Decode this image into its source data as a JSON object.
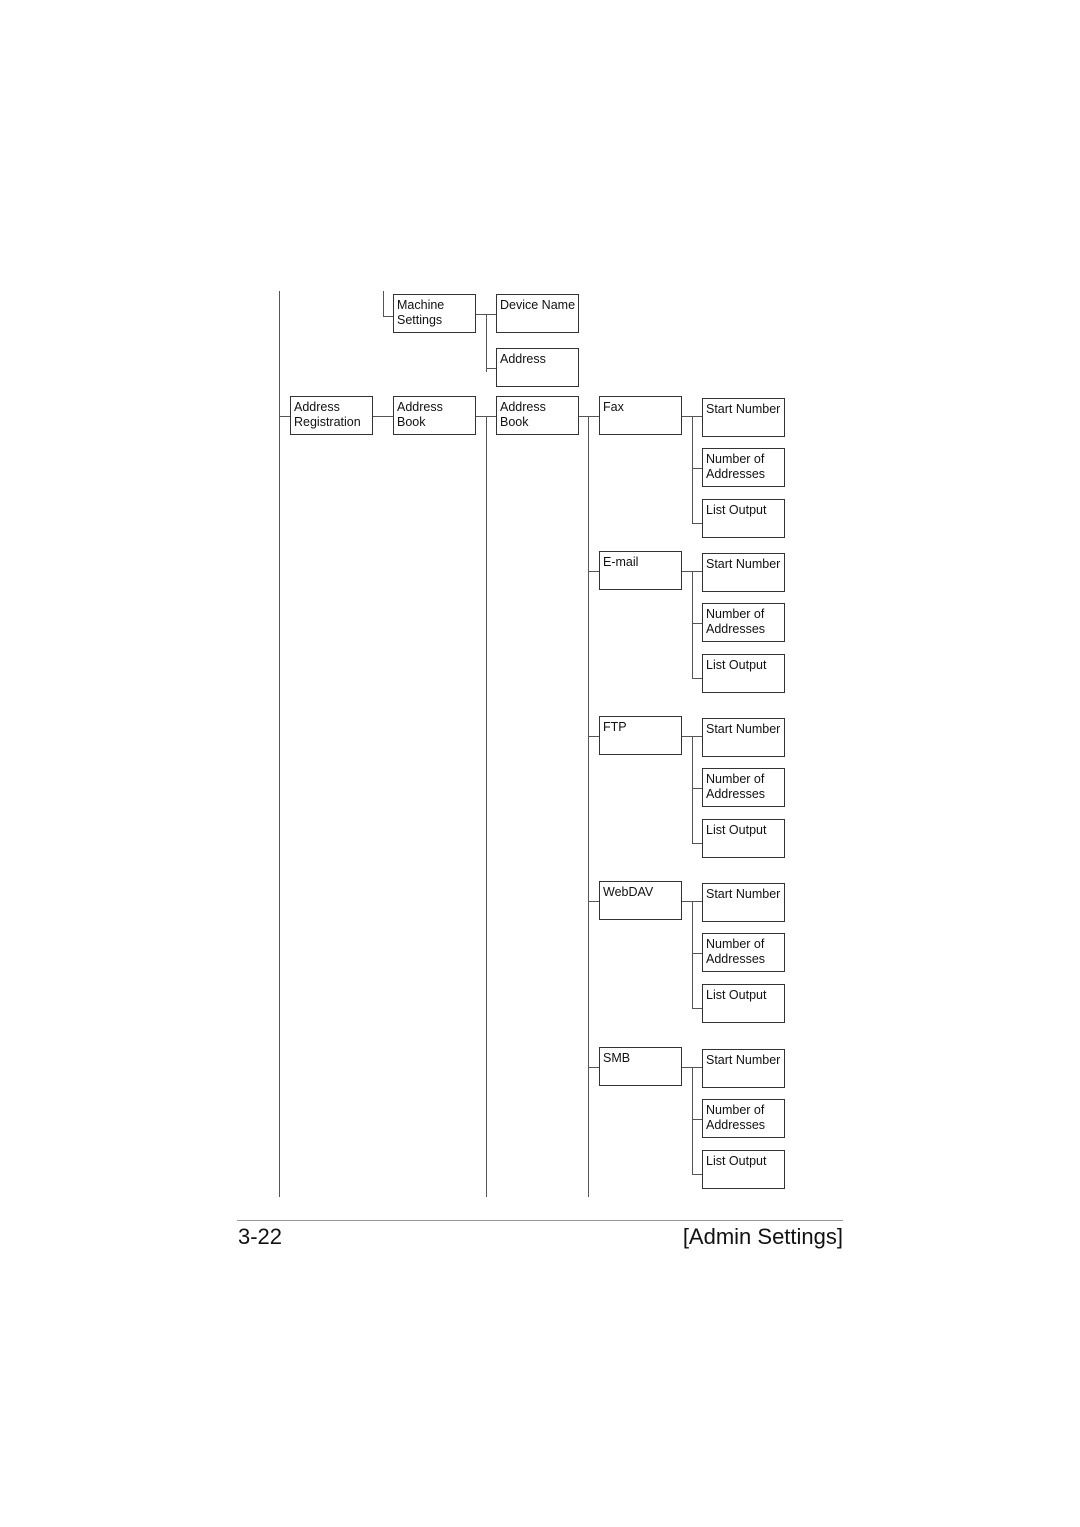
{
  "footer": {
    "page_number": "3-22",
    "section": "[Admin Settings]"
  },
  "tree": {
    "machine_settings": {
      "label": "Machine\nSettings",
      "children": [
        "Device Name",
        "Address"
      ]
    },
    "address_registration": {
      "label": "Address\nRegistration",
      "child": "Address\nBook",
      "grandchild": "Address\nBook",
      "destinations": [
        {
          "label": "Fax",
          "children": [
            "Start Number",
            "Number of\nAddresses",
            "List Output"
          ]
        },
        {
          "label": "E-mail",
          "children": [
            "Start Number",
            "Number of\nAddresses",
            "List Output"
          ]
        },
        {
          "label": "FTP",
          "children": [
            "Start Number",
            "Number of\nAddresses",
            "List Output"
          ]
        },
        {
          "label": "WebDAV",
          "children": [
            "Start Number",
            "Number of\nAddresses",
            "List Output"
          ]
        },
        {
          "label": "SMB",
          "children": [
            "Start Number",
            "Number of\nAddresses",
            "List Output"
          ]
        }
      ]
    }
  }
}
